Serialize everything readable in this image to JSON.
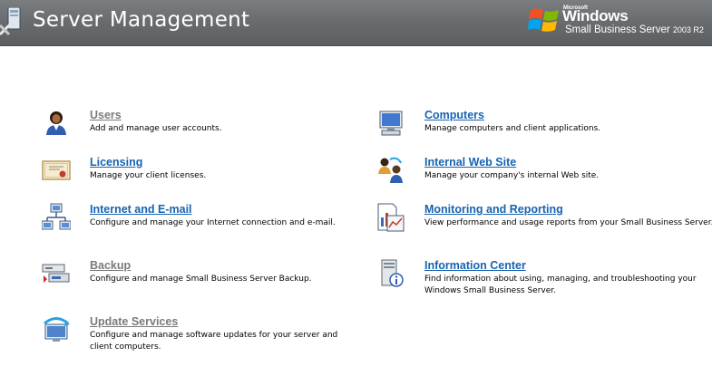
{
  "header": {
    "title": "Server Management",
    "brand_microsoft": "Microsoft",
    "brand_windows": "Windows",
    "brand_product": "Small Business Server",
    "brand_version": "2003 R2"
  },
  "items": [
    {
      "title": "Users",
      "description": "Add and manage user accounts.",
      "icon": "user-icon",
      "state": "inactive"
    },
    {
      "title": "Licensing",
      "description": "Manage your client licenses.",
      "icon": "certificate-icon",
      "state": "active"
    },
    {
      "title": "Internet and E-mail",
      "description": "Configure and manage your Internet connection and e-mail.",
      "icon": "network-icon",
      "state": "active"
    },
    {
      "title": "Backup",
      "description": "Configure and manage Small Business Server Backup.",
      "icon": "backup-icon",
      "state": "inactive"
    },
    {
      "title": "Update Services",
      "description": "Configure and manage software updates for your server and client computers.",
      "icon": "update-icon",
      "state": "inactive"
    },
    {
      "title": "Computers",
      "description": "Manage computers and client applications.",
      "icon": "computer-icon",
      "state": "active"
    },
    {
      "title": "Internal Web Site",
      "description": "Manage your company's internal Web site.",
      "icon": "web-site-icon",
      "state": "active"
    },
    {
      "title": "Monitoring and Reporting",
      "description": "View performance and usage reports from your Small Business Server.",
      "icon": "report-icon",
      "state": "active"
    },
    {
      "title": "Information Center",
      "description": "Find information about using, managing, and troubleshooting your Windows Small Business Server.",
      "icon": "information-icon",
      "state": "active"
    }
  ]
}
